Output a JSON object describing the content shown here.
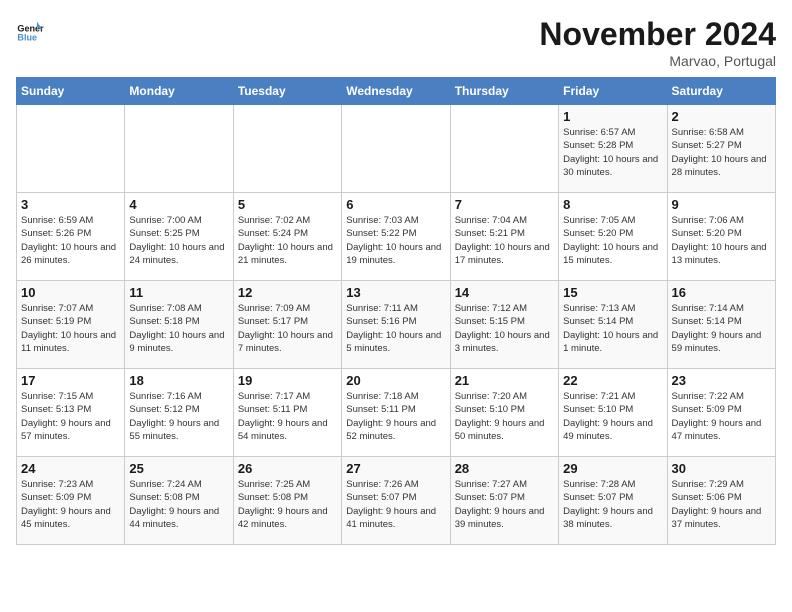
{
  "header": {
    "logo_line1": "General",
    "logo_line2": "Blue",
    "month_title": "November 2024",
    "location": "Marvao, Portugal"
  },
  "weekdays": [
    "Sunday",
    "Monday",
    "Tuesday",
    "Wednesday",
    "Thursday",
    "Friday",
    "Saturday"
  ],
  "weeks": [
    [
      {
        "day": "",
        "info": ""
      },
      {
        "day": "",
        "info": ""
      },
      {
        "day": "",
        "info": ""
      },
      {
        "day": "",
        "info": ""
      },
      {
        "day": "",
        "info": ""
      },
      {
        "day": "1",
        "info": "Sunrise: 6:57 AM\nSunset: 5:28 PM\nDaylight: 10 hours and 30 minutes."
      },
      {
        "day": "2",
        "info": "Sunrise: 6:58 AM\nSunset: 5:27 PM\nDaylight: 10 hours and 28 minutes."
      }
    ],
    [
      {
        "day": "3",
        "info": "Sunrise: 6:59 AM\nSunset: 5:26 PM\nDaylight: 10 hours and 26 minutes."
      },
      {
        "day": "4",
        "info": "Sunrise: 7:00 AM\nSunset: 5:25 PM\nDaylight: 10 hours and 24 minutes."
      },
      {
        "day": "5",
        "info": "Sunrise: 7:02 AM\nSunset: 5:24 PM\nDaylight: 10 hours and 21 minutes."
      },
      {
        "day": "6",
        "info": "Sunrise: 7:03 AM\nSunset: 5:22 PM\nDaylight: 10 hours and 19 minutes."
      },
      {
        "day": "7",
        "info": "Sunrise: 7:04 AM\nSunset: 5:21 PM\nDaylight: 10 hours and 17 minutes."
      },
      {
        "day": "8",
        "info": "Sunrise: 7:05 AM\nSunset: 5:20 PM\nDaylight: 10 hours and 15 minutes."
      },
      {
        "day": "9",
        "info": "Sunrise: 7:06 AM\nSunset: 5:20 PM\nDaylight: 10 hours and 13 minutes."
      }
    ],
    [
      {
        "day": "10",
        "info": "Sunrise: 7:07 AM\nSunset: 5:19 PM\nDaylight: 10 hours and 11 minutes."
      },
      {
        "day": "11",
        "info": "Sunrise: 7:08 AM\nSunset: 5:18 PM\nDaylight: 10 hours and 9 minutes."
      },
      {
        "day": "12",
        "info": "Sunrise: 7:09 AM\nSunset: 5:17 PM\nDaylight: 10 hours and 7 minutes."
      },
      {
        "day": "13",
        "info": "Sunrise: 7:11 AM\nSunset: 5:16 PM\nDaylight: 10 hours and 5 minutes."
      },
      {
        "day": "14",
        "info": "Sunrise: 7:12 AM\nSunset: 5:15 PM\nDaylight: 10 hours and 3 minutes."
      },
      {
        "day": "15",
        "info": "Sunrise: 7:13 AM\nSunset: 5:14 PM\nDaylight: 10 hours and 1 minute."
      },
      {
        "day": "16",
        "info": "Sunrise: 7:14 AM\nSunset: 5:14 PM\nDaylight: 9 hours and 59 minutes."
      }
    ],
    [
      {
        "day": "17",
        "info": "Sunrise: 7:15 AM\nSunset: 5:13 PM\nDaylight: 9 hours and 57 minutes."
      },
      {
        "day": "18",
        "info": "Sunrise: 7:16 AM\nSunset: 5:12 PM\nDaylight: 9 hours and 55 minutes."
      },
      {
        "day": "19",
        "info": "Sunrise: 7:17 AM\nSunset: 5:11 PM\nDaylight: 9 hours and 54 minutes."
      },
      {
        "day": "20",
        "info": "Sunrise: 7:18 AM\nSunset: 5:11 PM\nDaylight: 9 hours and 52 minutes."
      },
      {
        "day": "21",
        "info": "Sunrise: 7:20 AM\nSunset: 5:10 PM\nDaylight: 9 hours and 50 minutes."
      },
      {
        "day": "22",
        "info": "Sunrise: 7:21 AM\nSunset: 5:10 PM\nDaylight: 9 hours and 49 minutes."
      },
      {
        "day": "23",
        "info": "Sunrise: 7:22 AM\nSunset: 5:09 PM\nDaylight: 9 hours and 47 minutes."
      }
    ],
    [
      {
        "day": "24",
        "info": "Sunrise: 7:23 AM\nSunset: 5:09 PM\nDaylight: 9 hours and 45 minutes."
      },
      {
        "day": "25",
        "info": "Sunrise: 7:24 AM\nSunset: 5:08 PM\nDaylight: 9 hours and 44 minutes."
      },
      {
        "day": "26",
        "info": "Sunrise: 7:25 AM\nSunset: 5:08 PM\nDaylight: 9 hours and 42 minutes."
      },
      {
        "day": "27",
        "info": "Sunrise: 7:26 AM\nSunset: 5:07 PM\nDaylight: 9 hours and 41 minutes."
      },
      {
        "day": "28",
        "info": "Sunrise: 7:27 AM\nSunset: 5:07 PM\nDaylight: 9 hours and 39 minutes."
      },
      {
        "day": "29",
        "info": "Sunrise: 7:28 AM\nSunset: 5:07 PM\nDaylight: 9 hours and 38 minutes."
      },
      {
        "day": "30",
        "info": "Sunrise: 7:29 AM\nSunset: 5:06 PM\nDaylight: 9 hours and 37 minutes."
      }
    ]
  ]
}
